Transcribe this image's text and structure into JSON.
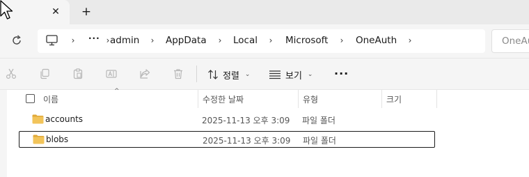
{
  "tab": {
    "close_glyph": "✕",
    "new_tab_glyph": "+"
  },
  "address": {
    "overflow_glyph": "···",
    "breadcrumbs": [
      "admin",
      "AppData",
      "Local",
      "Microsoft",
      "OneAuth"
    ],
    "search_placeholder": "OneAu"
  },
  "commands": {
    "icons": [
      "cut-icon",
      "copy-icon",
      "paste-icon",
      "rename-icon",
      "share-icon",
      "delete-icon"
    ],
    "sort_label": "정렬",
    "view_label": "보기",
    "more_glyph": "···"
  },
  "columns": {
    "name": "이름",
    "date": "수정한 날짜",
    "type": "유형",
    "size": "크기"
  },
  "rows": [
    {
      "name": "accounts",
      "date": "2025-11-13 오후 3:09",
      "type": "파일 폴더",
      "selected": false
    },
    {
      "name": "blobs",
      "date": "2025-11-13 오후 3:09",
      "type": "파일 폴더",
      "selected": true
    }
  ],
  "colors": {
    "folder": "#f2c45a",
    "folder_dark": "#e0a93a",
    "disabled_icon": "#b7b7b7"
  }
}
